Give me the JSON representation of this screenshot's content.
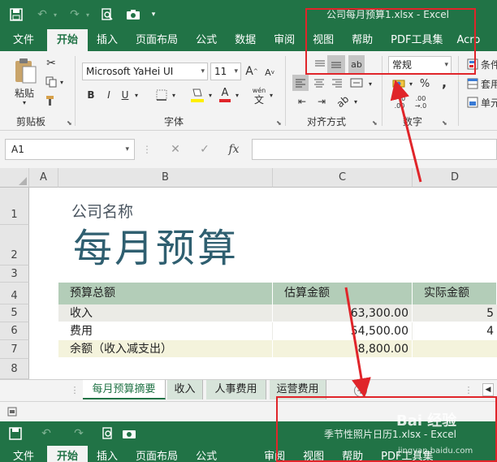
{
  "window": {
    "title": "公司每月预算1.xlsx  -  Excel"
  },
  "qat": {
    "save_icon": "save-icon",
    "undo_icon": "undo-icon",
    "redo_icon": "redo-icon",
    "preview_icon": "print-preview-icon",
    "camera_icon": "camera-icon"
  },
  "tabs": [
    "文件",
    "开始",
    "插入",
    "页面布局",
    "公式",
    "数据",
    "审阅",
    "视图",
    "帮助",
    "PDF工具集",
    "Acro"
  ],
  "active_tab": "开始",
  "ribbon": {
    "paste_label": "粘贴",
    "clipboard_label": "剪贴板",
    "font_name": "Microsoft YaHei UI",
    "font_size": "11",
    "font_label": "字体",
    "bold": "B",
    "italic": "I",
    "underline": "U",
    "font_color_letter": "A",
    "wen_label": "wén",
    "wen_char": "文",
    "alignment_label": "对齐方式",
    "number_format": "常规",
    "number_label": "数字",
    "percent": "%",
    "comma": ",",
    "inc_decimal": "←.0\n.00",
    "dec_decimal": ".00\n→.0",
    "styles": [
      "条件",
      "套用",
      "单元"
    ],
    "font_grow": "A",
    "font_shrink": "A"
  },
  "formula_bar": {
    "name_box": "A1",
    "fx": "fx",
    "value": ""
  },
  "columns": [
    "A",
    "B",
    "C",
    "D"
  ],
  "rows": [
    "1",
    "2",
    "3",
    "4",
    "5",
    "6",
    "7",
    "8"
  ],
  "sheet": {
    "company": "公司名称",
    "title": "每月预算",
    "table_header": [
      "预算总额",
      "估算金额",
      "实际金额"
    ],
    "table_rows": [
      {
        "label": "收入",
        "estimate": "63,300.00",
        "actual": "5"
      },
      {
        "label": "费用",
        "estimate": "54,500.00",
        "actual": "4"
      },
      {
        "label": "余额（收入减支出）",
        "estimate": "8,800.00",
        "actual": ""
      }
    ]
  },
  "sheet_tabs": [
    "每月预算摘要",
    "收入",
    "人事费用",
    "运营费用"
  ],
  "active_sheet": "每月预算摘要",
  "second_window": {
    "title": "季节性照片日历1.xlsx  -  Excel",
    "tabs": [
      "文件",
      "开始",
      "插入",
      "页面布局",
      "公式",
      "审阅",
      "视图",
      "帮助",
      "PDF工具集"
    ]
  },
  "watermark": {
    "brand": "Bai 经验",
    "url": "jingyan.baidu.com"
  },
  "colors": {
    "excel_green": "#217346",
    "header_green": "#b3cdb8",
    "annotation_red": "#e0252a",
    "title_blue": "#2f5f70"
  }
}
